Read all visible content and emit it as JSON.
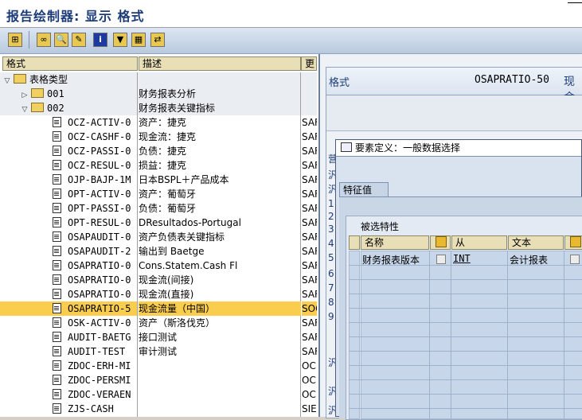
{
  "window": {
    "title": "报告绘制器: 显示 格式"
  },
  "tree": {
    "headers": {
      "col1": "格式",
      "col2": "描述",
      "col3": "更"
    },
    "root": {
      "label": "表格类型"
    },
    "groups": [
      {
        "code": "001",
        "desc": "财务报表分析"
      },
      {
        "code": "002",
        "desc": "财务报表关键指标"
      }
    ],
    "items": [
      {
        "name": "OCZ-ACTIV-0",
        "desc": "资产：捷克",
        "more": "SAF"
      },
      {
        "name": "OCZ-CASHF-0",
        "desc": "现金流：捷克",
        "more": "SAF"
      },
      {
        "name": "OCZ-PASSI-0",
        "desc": "负债：捷克",
        "more": "SAF"
      },
      {
        "name": "OCZ-RESUL-0",
        "desc": "损益：捷克",
        "more": "SAF"
      },
      {
        "name": "OJP-BAJP-1M",
        "desc": "日本BSPL＋产品成本",
        "more": "SAF"
      },
      {
        "name": "OPT-ACTIV-0",
        "desc": "资产：葡萄牙",
        "more": "SAF"
      },
      {
        "name": "OPT-PASSI-0",
        "desc": "负债：葡萄牙",
        "more": "SAF"
      },
      {
        "name": "OPT-RESUL-0",
        "desc": "DResultados-Portugal",
        "more": "SAF"
      },
      {
        "name": "OSAPAUDIT-0",
        "desc": "资产负债表关键指标",
        "more": "SAF"
      },
      {
        "name": "OSAPAUDIT-2",
        "desc": "输出到 Baetge",
        "more": "SAF"
      },
      {
        "name": "OSAPRATIO-0",
        "desc": "Cons.Statem.Cash Fl",
        "more": "SAF"
      },
      {
        "name": "OSAPRATIO-0",
        "desc": "现金流(间接)",
        "more": "SAF"
      },
      {
        "name": "OSAPRATIO-0",
        "desc": "现金流(直接)",
        "more": "SAF"
      },
      {
        "name": "OSAPRATIO-5",
        "desc": "现金流量（中国）",
        "more": "SOO"
      },
      {
        "name": "OSK-ACTIV-0",
        "desc": "资产（斯洛伐克）",
        "more": "SAF"
      },
      {
        "name": "AUDIT-BAETG",
        "desc": "接口测试",
        "more": "SAF"
      },
      {
        "name": "AUDIT-TEST",
        "desc": "审计测试",
        "more": "SAF"
      },
      {
        "name": "ZDOC-ERH-MI",
        "desc": "",
        "more": "OC"
      },
      {
        "name": "ZDOC-PERSMI",
        "desc": "",
        "more": "OC"
      },
      {
        "name": "ZDOC-VERAEN",
        "desc": "",
        "more": "OC"
      },
      {
        "name": "ZJS-CASH",
        "desc": "",
        "more": "SIE"
      }
    ]
  },
  "right": {
    "label": "格式",
    "code": "OSAPRATIO-50",
    "name": "现金",
    "edge_chars": [
      "营",
      "汎",
      "汎",
      "1",
      "2",
      "3",
      "4",
      "5",
      "6",
      "7",
      "8",
      "9",
      "汎",
      "汎",
      "汎"
    ]
  },
  "dialog": {
    "title": "要素定义：一般数据选择",
    "tab": "特征值",
    "group": "被选特性",
    "columns": [
      "名称",
      "从",
      "文本"
    ],
    "rows": [
      {
        "name": "财务报表版本",
        "from": "INT",
        "text": "会计报表"
      }
    ]
  }
}
